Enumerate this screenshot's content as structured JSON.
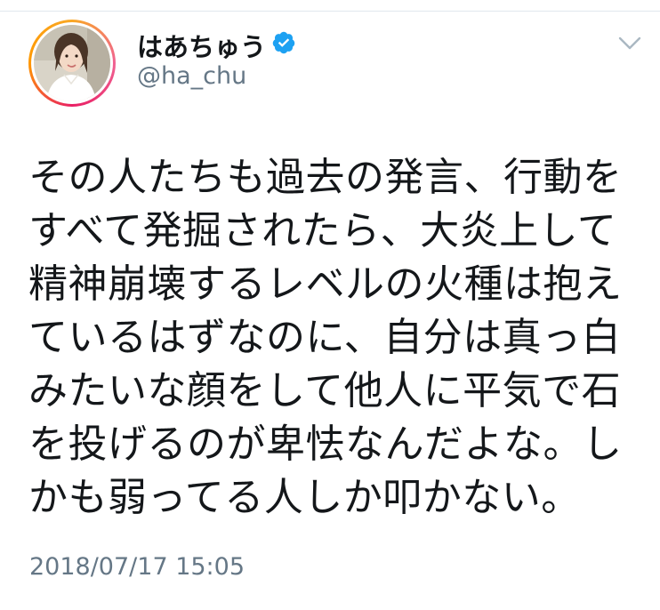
{
  "author": {
    "display_name": "はあちゅう",
    "handle": "@ha_chu",
    "verified": true,
    "avatar_icon": "profile-photo"
  },
  "menu": {
    "icon": "chevron-down-icon"
  },
  "tweet": {
    "lines": [
      "その人たちも過去の発言、行動を",
      "すべて発掘されたら、大炎上して",
      "精神崩壊するレベルの火種は抱え",
      "ているはずなのに、自分は真っ白",
      "みたいな顔をして他人に平気で石",
      "を投げるのが卑怯なんだよな。し",
      "かも弱ってる人しか叩かない。"
    ],
    "timestamp": "2018/07/17 15:05"
  },
  "colors": {
    "text_primary": "#14171a",
    "text_secondary": "#657786",
    "verified_blue": "#1da1f2",
    "divider": "#e1e8ed"
  }
}
